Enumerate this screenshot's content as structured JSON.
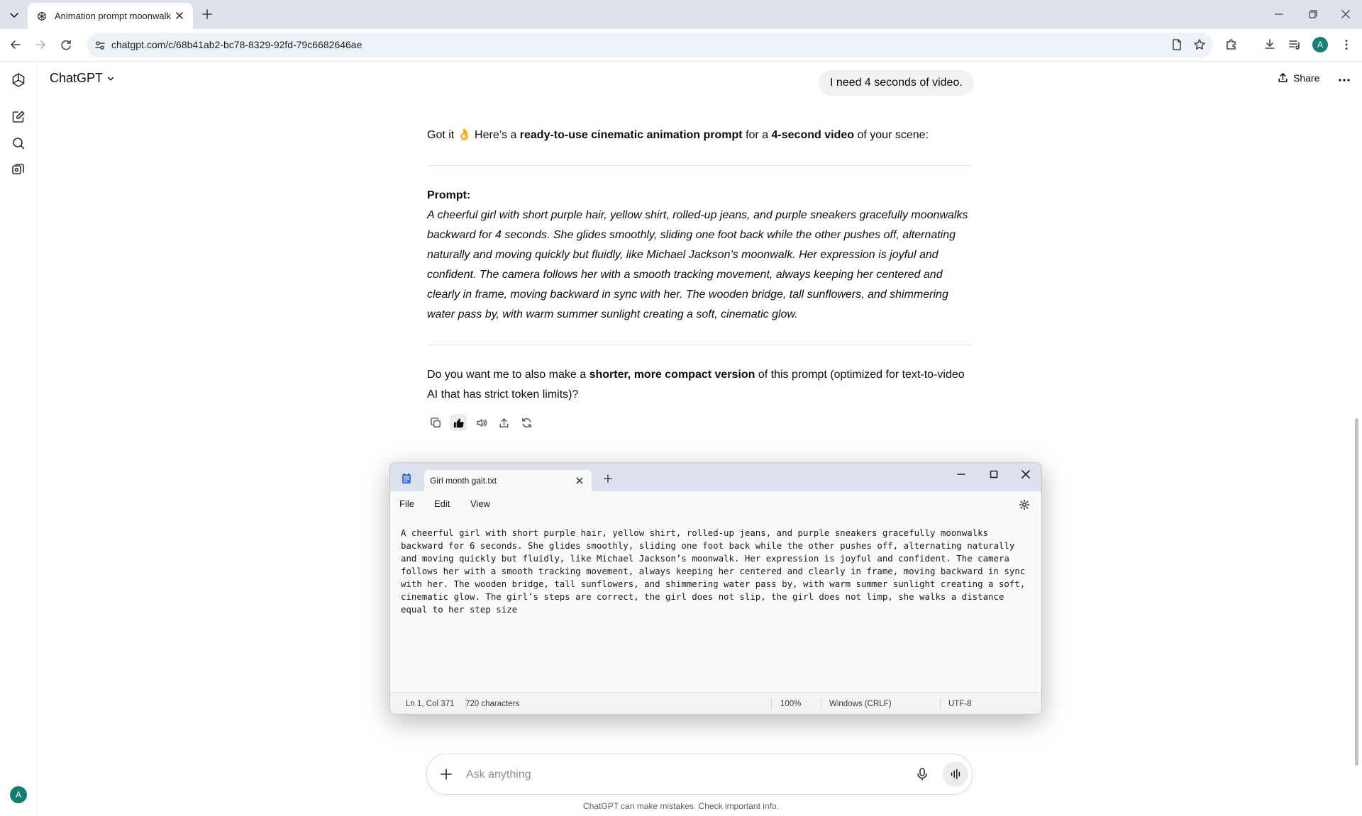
{
  "browser": {
    "tab_title": "Animation prompt moonwalk",
    "url": "chatgpt.com/c/68b41ab2-bc78-8329-92fd-79c6682646ae",
    "profile_initial": "A"
  },
  "app": {
    "model_label": "ChatGPT",
    "share_label": "Share",
    "user_initial": "A"
  },
  "chat": {
    "user_message": "I need 4 seconds of video.",
    "intro": {
      "t1": "Got it 👌 Here’s a ",
      "b1": "ready-to-use cinematic animation prompt",
      "t2": " for a ",
      "b2": "4-second video",
      "t3": " of your scene:"
    },
    "prompt_label": "Prompt:",
    "prompt_body": "A cheerful girl with short purple hair, yellow shirt, rolled-up jeans, and purple sneakers gracefully moonwalks backward for 4 seconds. She glides smoothly, sliding one foot back while the other pushes off, alternating naturally and moving quickly but fluidly, like Michael Jackson’s moonwalk. Her expression is joyful and confident. The camera follows her with a smooth tracking movement, always keeping her centered and clearly in frame, moving backward in sync with her. The wooden bridge, tall sunflowers, and shimmering water pass by, with warm summer sunlight creating a soft, cinematic glow.",
    "followup": {
      "t1": "Do you want me to also make a ",
      "b1": "shorter, more compact version",
      "t2": " of this prompt (optimized for text-to-video AI that has strict token limits)?"
    }
  },
  "notepad": {
    "tab_title": "Girl month gait.txt",
    "menu": {
      "file": "File",
      "edit": "Edit",
      "view": "View"
    },
    "content": "A cheerful girl with short purple hair, yellow shirt, rolled-up jeans, and purple sneakers gracefully moonwalks backward for 6 seconds. She glides smoothly, sliding one foot back while the other pushes off, alternating naturally and moving quickly but fluidly, like Michael Jackson’s moonwalk. Her expression is joyful and confident. The camera follows her with a smooth tracking movement, always keeping her centered and clearly in frame, moving backward in sync with her. The wooden bridge, tall sunflowers, and shimmering water pass by, with warm summer sunlight creating a soft, cinematic glow. The girl’s steps are correct, the girl does not slip, the girl does not limp, she walks a distance equal to her step size",
    "status": {
      "position": "Ln 1, Col 371",
      "characters": "720 characters",
      "zoom": "100%",
      "line_ending": "Windows (CRLF)",
      "encoding": "UTF-8"
    }
  },
  "composer": {
    "placeholder": "Ask anything",
    "disclaimer": "ChatGPT can make mistakes. Check important info."
  },
  "colors": {
    "tabstrip_bg": "#dee3eb",
    "notepad_titlebar": "#dde1ed",
    "avatar": "#127e6f"
  }
}
